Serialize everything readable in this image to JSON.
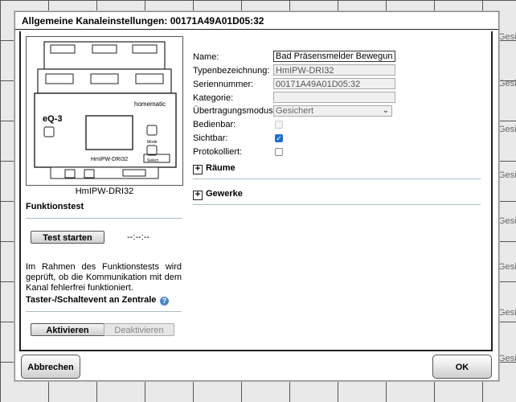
{
  "dialog": {
    "title": "Allgemeine Kanaleinstellungen: 00171A49A01D05:32"
  },
  "device": {
    "caption": "HmIPW-DRI32",
    "image_brand": "homematic",
    "image_logo": "eQ-3",
    "image_model": "HmIPW-DRI32",
    "image_btn_mode": "Mode",
    "image_btn_select": "Select"
  },
  "funktionstest": {
    "title": "Funktionstest",
    "button_label": "Test starten",
    "time": "--:--:--",
    "description": "Im Rahmen des Funktionstests wird geprüft, ob die Kommunikation mit dem Kanal fehlerfrei funktioniert."
  },
  "taster": {
    "title": "Taster-/Schaltevent an Zentrale",
    "activate_label": "Aktivieren",
    "deactivate_label": "Deaktivieren"
  },
  "form": {
    "name_label": "Name:",
    "name_value": "Bad Präsensmelder Bewegung erl",
    "typ_label": "Typenbezeichnung:",
    "typ_value": "HmIPW-DRI32",
    "serial_label": "Seriennummer:",
    "serial_value": "00171A49A01D05:32",
    "kategorie_label": "Kategorie:",
    "kategorie_value": "",
    "uebertragung_label": "Übertragungsmodus:",
    "uebertragung_value": "Gesichert",
    "bedienbar_label": "Bedienbar:",
    "sichtbar_label": "Sichtbar:",
    "protokolliert_label": "Protokolliert:"
  },
  "checkboxes": {
    "bedienbar": false,
    "sichtbar": true,
    "protokolliert": false
  },
  "sections": {
    "raeume": "Räume",
    "gewerke": "Gewerke"
  },
  "footer": {
    "cancel_label": "Abbrechen",
    "ok_label": "OK"
  },
  "background": {
    "column_text": "Gesic"
  }
}
